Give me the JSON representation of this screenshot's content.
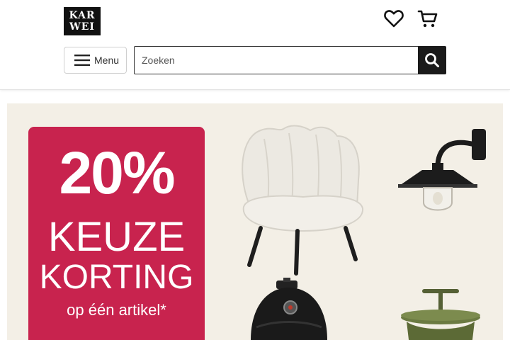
{
  "brand": {
    "logo_line1": "KAR",
    "logo_line2": "WEI"
  },
  "header": {
    "menu_label": "Menu",
    "search_placeholder": "Zoeken",
    "favorites_icon": "heart-icon",
    "cart_icon": "cart-icon",
    "search_icon": "search-icon"
  },
  "banner": {
    "promo_line1": "20%",
    "promo_line2": "KEUZE",
    "promo_line3": "KORTING",
    "promo_line4": "op één artikel*",
    "promo_color": "#c8234e",
    "products": [
      "armchair",
      "wall-lamp",
      "kamado-grill",
      "side-table"
    ]
  }
}
